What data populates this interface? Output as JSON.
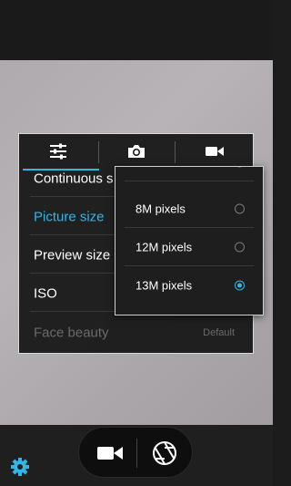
{
  "settings_menu": {
    "tabs": [
      {
        "icon": "sliders-icon",
        "selected": true
      },
      {
        "icon": "camera-icon",
        "selected": false
      },
      {
        "icon": "video-icon",
        "selected": false
      }
    ],
    "rows": [
      {
        "label": "Continuous s"
      },
      {
        "label": "Picture size"
      },
      {
        "label": "Preview size"
      },
      {
        "label": "ISO"
      },
      {
        "label": "Face beauty",
        "value": "Default"
      }
    ]
  },
  "picture_size_dropdown": {
    "options": [
      {
        "label": "8M pixels",
        "selected": false
      },
      {
        "label": "12M pixels",
        "selected": false
      },
      {
        "label": "13M pixels",
        "selected": true
      }
    ]
  },
  "bottom_controls": {
    "settings_icon": "gear-icon",
    "video_icon": "video-camera-icon",
    "shutter_icon": "shutter-icon"
  },
  "colors": {
    "accent": "#33b5e5",
    "panel_bg": "#141414",
    "text": "#ffffff",
    "disabled_text": "#6a6a6a"
  }
}
